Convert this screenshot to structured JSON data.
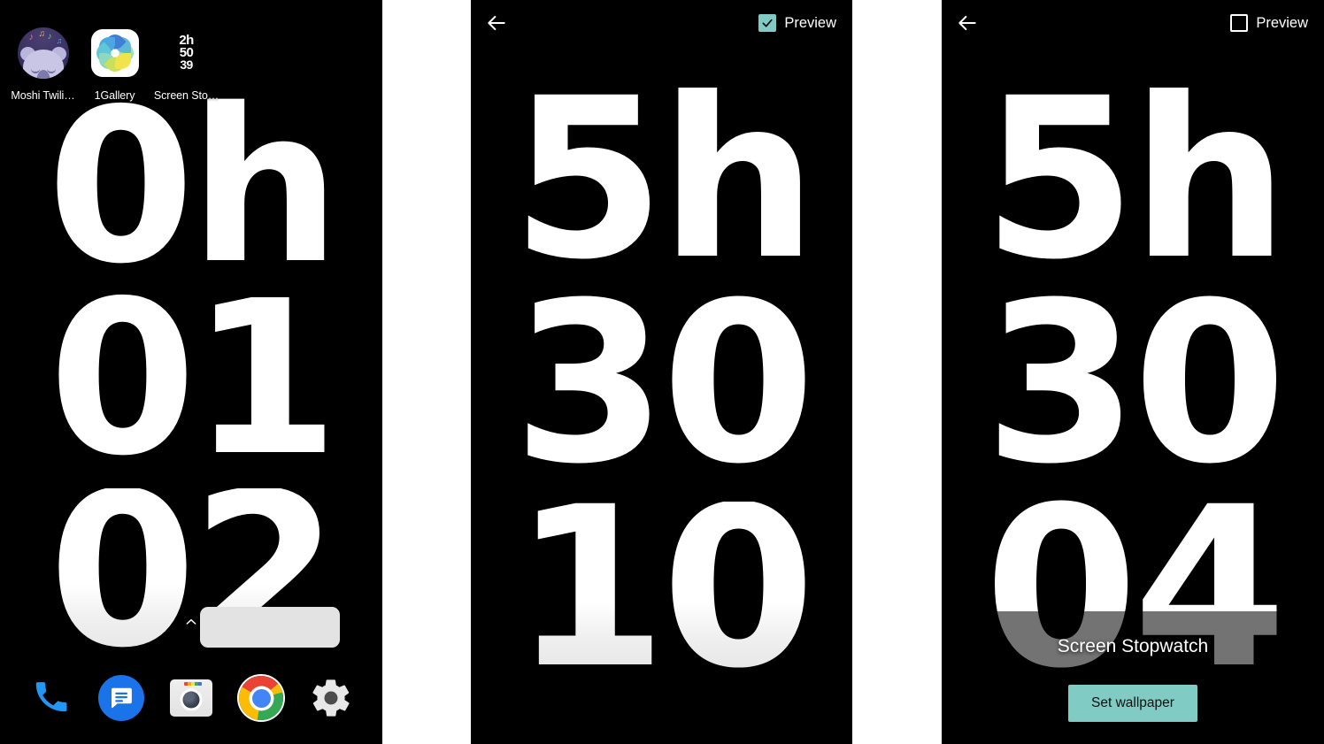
{
  "panels": {
    "home": {
      "name": "Android home screen",
      "apps": [
        {
          "label": "Moshi Twili…",
          "icon": "moshi-twilight-icon"
        },
        {
          "label": "1Gallery",
          "icon": "gallery-icon"
        },
        {
          "label": "Screen Sto…",
          "icon": "screen-stopwatch-icon"
        }
      ],
      "stopwatch_icon": {
        "line1": "2h",
        "line2": "50",
        "line3": "39"
      },
      "clock_rows": [
        "0h",
        "01",
        "02"
      ],
      "dock": [
        {
          "label": "Phone",
          "icon": "phone-icon"
        },
        {
          "label": "Messages",
          "icon": "messages-icon"
        },
        {
          "label": "Camera",
          "icon": "camera-icon"
        },
        {
          "label": "Chrome",
          "icon": "chrome-icon"
        },
        {
          "label": "Settings",
          "icon": "settings-gear-icon"
        }
      ],
      "drawer_hint_icon": "chevron-up-icon"
    },
    "preview": {
      "back_icon": "back-arrow-icon",
      "preview_label": "Preview",
      "preview_checked": true,
      "clock_rows": [
        "5h",
        "30",
        "10"
      ]
    },
    "set": {
      "back_icon": "back-arrow-icon",
      "preview_label": "Preview",
      "preview_checked": false,
      "clock_rows": [
        "5h",
        "30",
        "04"
      ],
      "wallpaper_title": "Screen Stopwatch",
      "set_wallpaper_label": "Set wallpaper"
    }
  },
  "colors": {
    "background": "#000000",
    "gutter": "#ffffff",
    "accent_teal": "#80cbc4",
    "digit_white": "#ffffff",
    "widget_grey": "#e3e3e3",
    "phone_blue": "#2196f3",
    "messages_blue": "#1a73e8"
  }
}
